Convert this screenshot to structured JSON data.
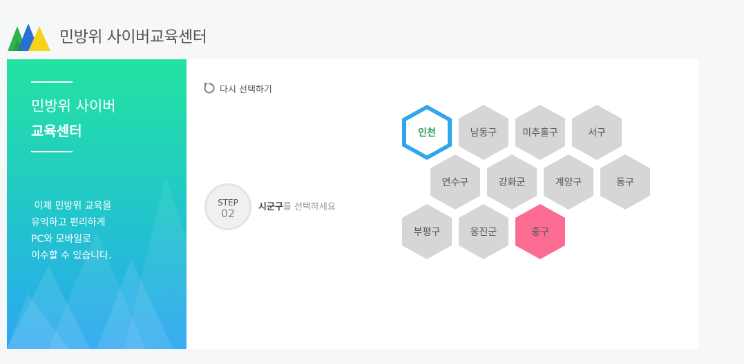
{
  "header": {
    "site_title": "민방위 사이버교육센터"
  },
  "left_panel": {
    "title_line1": "민방위 사이버",
    "title_line2": "교육센터",
    "description": [
      " 이제 민방위 교육을",
      "유익하고 편리하게",
      "PC와 모바일로",
      "이수할 수 있습니다."
    ]
  },
  "main": {
    "reset_label": "다시 선택하기",
    "step": {
      "word": "STEP",
      "number": "02",
      "instruction_strong": "시군구",
      "instruction_rest": "를 선택하세요"
    },
    "regions": [
      {
        "label": "인천",
        "state": "selected"
      },
      {
        "label": "남동구",
        "state": "normal"
      },
      {
        "label": "미추홀구",
        "state": "normal"
      },
      {
        "label": "서구",
        "state": "normal"
      },
      {
        "label": "연수구",
        "state": "normal"
      },
      {
        "label": "강화군",
        "state": "normal"
      },
      {
        "label": "계양구",
        "state": "normal"
      },
      {
        "label": "동구",
        "state": "normal"
      },
      {
        "label": "부평구",
        "state": "normal"
      },
      {
        "label": "옹진군",
        "state": "normal"
      },
      {
        "label": "중구",
        "state": "highlighted"
      }
    ]
  },
  "colors": {
    "selected_border": "#2fa6ec",
    "highlight": "#fb6b92",
    "hex_default": "#d6d6d6",
    "panel_top": "#23e2a0",
    "panel_bottom": "#2aa6f2"
  }
}
